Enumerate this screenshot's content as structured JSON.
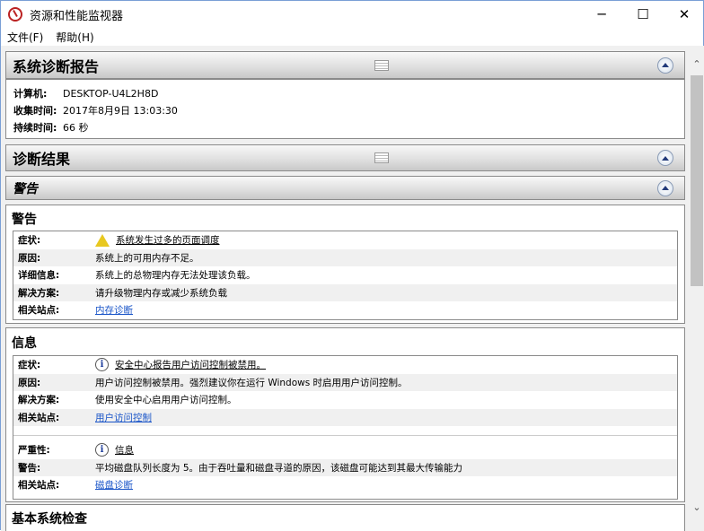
{
  "window": {
    "title": "资源和性能监视器",
    "minimize": "─",
    "maximize": "☐",
    "close": "✕"
  },
  "menu": [
    "文件(F)",
    "帮助(H)"
  ],
  "report": {
    "title": "系统诊断报告",
    "fields": [
      {
        "label": "计算机:",
        "value": "DESKTOP-U4L2H8D"
      },
      {
        "label": "收集时间:",
        "value": "2017年8月9日  13:03:30"
      },
      {
        "label": "持续时间:",
        "value": "66 秒"
      }
    ]
  },
  "results": {
    "title": "诊断结果",
    "subtitle": "警告"
  },
  "warning": {
    "title": "警告",
    "rows": [
      {
        "label": "症状:",
        "value": "系统发生过多的页面调度",
        "icon": "warning-icon"
      },
      {
        "label": "原因:",
        "value": "系统上的可用内存不足。"
      },
      {
        "label": "详细信息:",
        "value": "系统上的总物理内存无法处理该负载。"
      },
      {
        "label": "解决方案:",
        "value": "请升级物理内存或减少系统负载"
      },
      {
        "label": "相关站点:",
        "value": "内存诊断",
        "link": true
      }
    ]
  },
  "info": {
    "title": "信息",
    "rows": [
      {
        "label": "症状:",
        "value": "安全中心报告用户访问控制被禁用。",
        "icon": "info-icon"
      },
      {
        "label": "原因:",
        "value": "用户访问控制被禁用。强烈建议你在运行 Windows 时启用用户访问控制。"
      },
      {
        "label": "解决方案:",
        "value": "使用安全中心启用用户访问控制。"
      },
      {
        "label": "相关站点:",
        "value": "用户访问控制",
        "link": true
      }
    ],
    "rows2": [
      {
        "label": "严重性:",
        "value": "信息",
        "icon": "info-icon"
      },
      {
        "label": "警告:",
        "value": "平均磁盘队列长度为 5。由于吞吐量和磁盘寻道的原因，该磁盘可能达到其最大传输能力"
      },
      {
        "label": "相关站点:",
        "value": "磁盘诊断",
        "link": true
      }
    ]
  },
  "basic": {
    "title": "基本系统检查"
  },
  "scrollbar": {
    "up": "⌃",
    "down": "⌄"
  }
}
